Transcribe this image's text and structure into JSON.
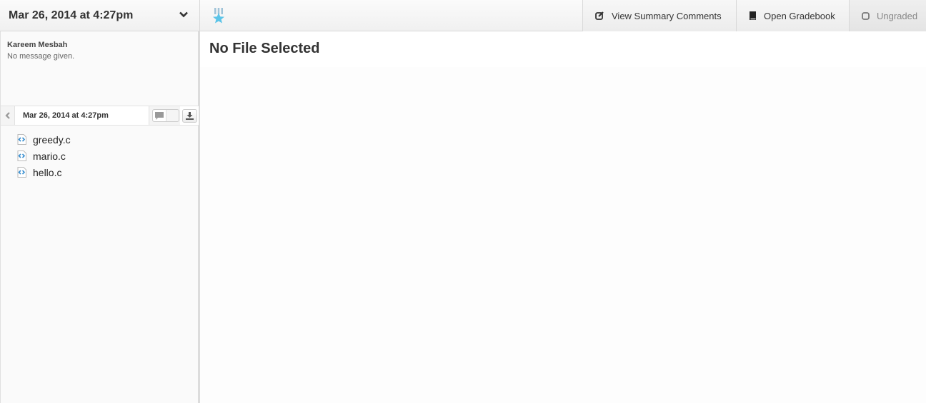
{
  "header": {
    "submission_date": "Mar 26, 2014 at 4:27pm",
    "badge_icon": "medal-star-icon",
    "buttons": {
      "summary": "View Summary Comments",
      "gradebook": "Open Gradebook",
      "ungraded": "Ungraded"
    }
  },
  "sidebar": {
    "author": "Kareem Mesbah",
    "message": "No message given.",
    "subbar_date": "Mar 26, 2014 at 4:27pm",
    "files": [
      {
        "name": "greedy.c",
        "icon": "code-file-icon"
      },
      {
        "name": "mario.c",
        "icon": "code-file-icon"
      },
      {
        "name": "hello.c",
        "icon": "code-file-icon"
      }
    ]
  },
  "main": {
    "title": "No File Selected"
  },
  "colors": {
    "accent": "#5bc4e8"
  }
}
